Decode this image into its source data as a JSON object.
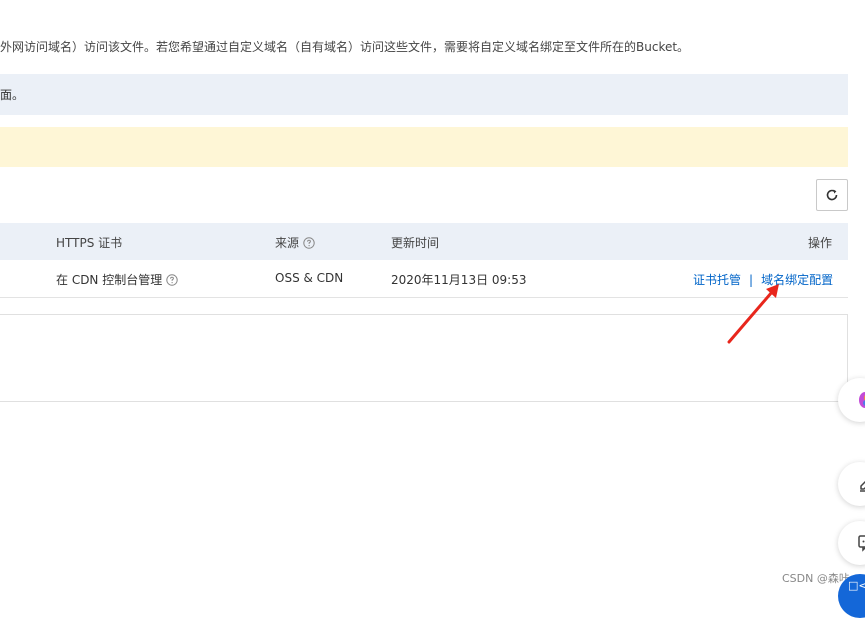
{
  "intro_text": "外网访问域名）访问该文件。若您希望通过自定义域名（自有域名）访问这些文件，需要将自定义域名绑定至文件所在的Bucket。",
  "info_bar_text": "面。",
  "toolbar": {
    "refresh_icon": "refresh-icon"
  },
  "table": {
    "headers": {
      "https_cert": "HTTPS 证书",
      "source": "来源",
      "updated": "更新时间",
      "actions": "操作"
    },
    "rows": [
      {
        "https_cert": "在 CDN 控制台管理",
        "source": "OSS & CDN",
        "updated": "2020年11月13日 09:53",
        "action_cert": "证书托管",
        "action_sep": "|",
        "action_bind": "域名绑定配置"
      }
    ]
  },
  "annotation": {
    "arrow_color": "#e8261c"
  },
  "watermark": "CSDN @森咔",
  "corner_bubble_text": "□<",
  "colors": {
    "link": "#0064c8",
    "info_bg": "#ebf0f7",
    "warn_bg": "#fef6d6"
  }
}
